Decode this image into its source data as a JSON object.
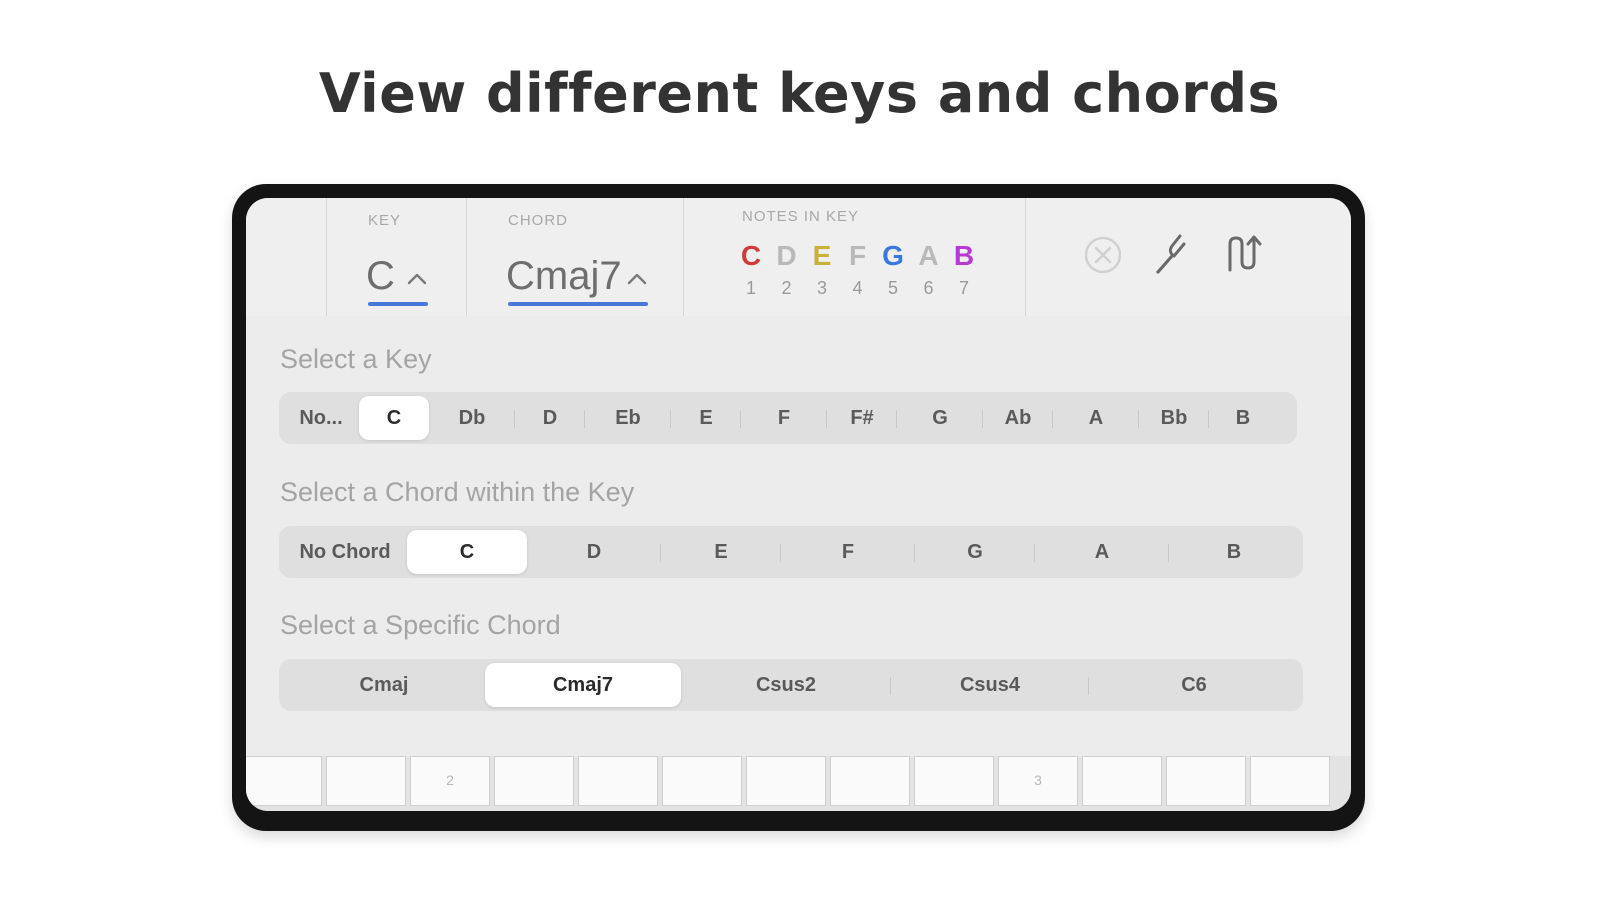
{
  "headline": "View different keys and chords",
  "toolbar": {
    "key": {
      "label": "KEY",
      "value": "C"
    },
    "chord": {
      "label": "CHORD",
      "value": "Cmaj7"
    },
    "notes_in_key": {
      "label": "NOTES IN KEY",
      "notes": [
        {
          "name": "C",
          "degree": "1",
          "color": "#d23a3a"
        },
        {
          "name": "D",
          "degree": "2",
          "color": "#b9b9b9"
        },
        {
          "name": "E",
          "degree": "3",
          "color": "#c9b23a"
        },
        {
          "name": "F",
          "degree": "4",
          "color": "#b9b9b9"
        },
        {
          "name": "G",
          "degree": "5",
          "color": "#3a78e0"
        },
        {
          "name": "A",
          "degree": "6",
          "color": "#b9b9b9"
        },
        {
          "name": "B",
          "degree": "7",
          "color": "#b63ad2"
        }
      ]
    },
    "icons": [
      "clear-circle-icon",
      "tuning-fork-icon",
      "transpose-icon"
    ]
  },
  "select_key": {
    "label": "Select a Key",
    "options": [
      "No...",
      "C",
      "Db",
      "D",
      "Eb",
      "E",
      "F",
      "F#",
      "G",
      "Ab",
      "A",
      "Bb",
      "B"
    ],
    "selected": "C"
  },
  "select_chord": {
    "label": "Select a Chord within the Key",
    "options": [
      "No Chord",
      "C",
      "D",
      "E",
      "F",
      "G",
      "A",
      "B"
    ],
    "selected": "C"
  },
  "select_specific": {
    "label": "Select a Specific Chord",
    "options": [
      "Cmaj",
      "Cmaj7",
      "Csus2",
      "Csus4",
      "C6"
    ],
    "selected": "Cmaj7"
  },
  "keyboard": {
    "labels": [
      "",
      "",
      "2",
      "",
      "",
      "",
      "",
      "",
      "",
      "3",
      "",
      "",
      ""
    ]
  },
  "colors": {
    "accent": "#4a78d8",
    "frame": "#141414",
    "panel": "#ececec"
  }
}
